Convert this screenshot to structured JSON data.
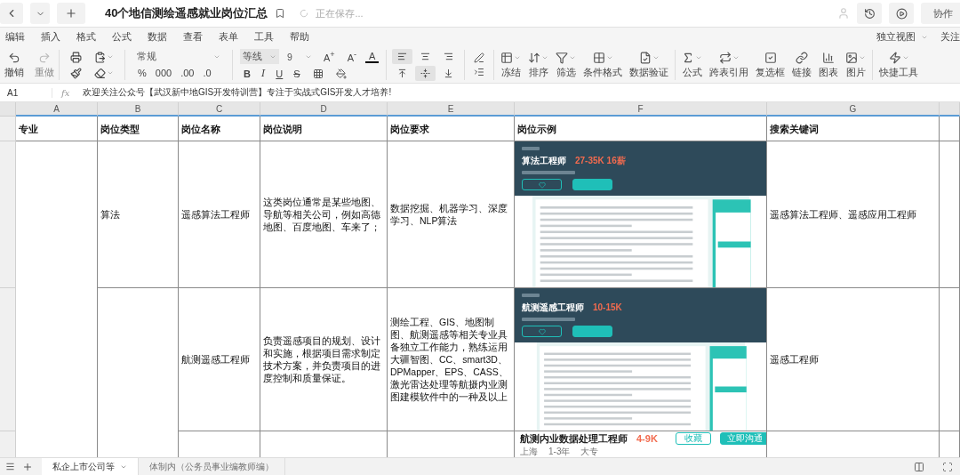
{
  "title_bar": {
    "title": "40个地信测绘遥感就业岗位汇总",
    "save_status": "正在保存...",
    "collab_button": "协作"
  },
  "menu": [
    "编辑",
    "插入",
    "格式",
    "公式",
    "数据",
    "查看",
    "表单",
    "工具",
    "帮助"
  ],
  "menu_right": {
    "view": "独立视图",
    "follow": "关注"
  },
  "toolbar": {
    "history": [
      {
        "kind": "undo",
        "label": "撤销",
        "disabled": false
      },
      {
        "kind": "redo",
        "label": "重做",
        "disabled": true
      }
    ],
    "number": {
      "format": "常规",
      "buttons": [
        "%",
        "000",
        ".00",
        ".0"
      ]
    },
    "font": {
      "name": "等线",
      "size": "9",
      "size_buttons": [
        "A$^{+}$",
        "A$^{-}$"
      ],
      "color_button": "A",
      "styles": [
        {
          "kind": "bold",
          "label": "B"
        },
        {
          "kind": "italic",
          "label": "I"
        },
        {
          "kind": "underline",
          "label": "U"
        },
        {
          "kind": "strike",
          "label": "S"
        }
      ]
    },
    "horizontal_align": [
      {
        "kind": "left",
        "selected": true
      },
      {
        "kind": "center",
        "selected": false
      },
      {
        "kind": "right",
        "selected": false
      }
    ],
    "vertical_align": [
      {
        "kind": "top",
        "selected": false
      },
      {
        "kind": "middle",
        "selected": true
      },
      {
        "kind": "bottom",
        "selected": false
      }
    ],
    "tools": [
      {
        "kind": "freeze",
        "label": "冻结",
        "dropdown": true
      },
      {
        "kind": "sort",
        "label": "排序",
        "dropdown": true
      },
      {
        "kind": "filter",
        "label": "筛选",
        "dropdown": true
      },
      {
        "kind": "conditional",
        "label": "条件格式",
        "dropdown": true
      },
      {
        "kind": "validation",
        "label": "数据验证",
        "dropdown": true
      }
    ],
    "insert_tools": [
      {
        "kind": "formula",
        "label": "公式",
        "dropdown": true
      },
      {
        "kind": "crossref",
        "label": "跨表引用",
        "dropdown": true
      },
      {
        "kind": "checkbox",
        "label": "复选框",
        "dropdown": false
      },
      {
        "kind": "link",
        "label": "链接",
        "dropdown": false
      },
      {
        "kind": "chart",
        "label": "图表",
        "dropdown": false
      },
      {
        "kind": "image",
        "label": "图片",
        "dropdown": true
      }
    ],
    "quick_tools": {
      "kind": "quick",
      "label": "快捷工具",
      "dropdown": true
    }
  },
  "formula_bar": {
    "cell": "A1",
    "fx": "fx",
    "value": "欢迎关注公众号【武汉新中地GIS开发特训营】专注于实战式GIS开发人才培养!"
  },
  "sheet": {
    "columns": [
      "A",
      "B",
      "C",
      "D",
      "E",
      "F",
      "G"
    ],
    "header_row": [
      "专业",
      "岗位类型",
      "岗位名称",
      "岗位说明",
      "岗位要求",
      "岗位示例",
      "搜索关键词"
    ],
    "rows": [
      {
        "type": "算法",
        "name": "遥感算法工程师",
        "description": "这类岗位通常是某些地图、导航等相关公司，例如高德地图、百度地图、车来了；",
        "requirements": "数据挖掘、机器学习、深度学习、NLP算法",
        "example": {
          "kind": "page",
          "title": "算法工程师",
          "salary": "27-35K 16薪"
        },
        "keywords": "遥感算法工程师、遥感应用工程师"
      },
      {
        "name": "航测遥感工程师",
        "description": "负责遥感项目的规划、设计和实施，根据项目需求制定技术方案，并负责项目的进度控制和质量保证。",
        "requirements": "测绘工程、GIS、地图制图、航测遥感等相关专业具备独立工作能力，熟练运用大疆智图、CC、smart3D、DPMapper、EPS、CASS、激光雷达处理等航摄内业测图建模软件中的一种及以上",
        "example": {
          "kind": "page",
          "title": "航测遥感工程师",
          "salary": "10-15K"
        },
        "keywords": "遥感工程师",
        "merged_with_above": {
          "category": true
        }
      },
      {
        "example": {
          "kind": "card",
          "title": "航测内业数据处理工程师",
          "salary": "4-9K",
          "meta": [
            "上海",
            "1-3年",
            "大专"
          ],
          "buttons": [
            "收藏",
            "立即沟通"
          ]
        },
        "merged_with_above": {
          "category": true,
          "type": true
        }
      }
    ]
  },
  "tabs": [
    {
      "label": "私企上市公司等",
      "selected": true
    },
    {
      "label": "体制内（公务员事业编教师编）",
      "selected": false
    }
  ]
}
